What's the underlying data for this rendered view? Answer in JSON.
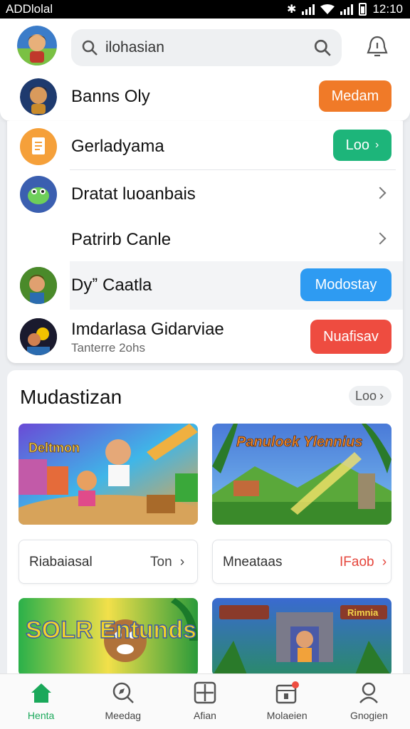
{
  "status_bar": {
    "carrier": "ADDlolal",
    "time": "12:10"
  },
  "header": {
    "search": {
      "value": "ilohasian"
    },
    "user": {
      "name": "Banns Oly",
      "button": "Medam"
    }
  },
  "list": [
    {
      "label": "Gerladyama",
      "button": "Loo"
    },
    {
      "label": "Dratat luoanbais"
    },
    {
      "label": "Patrirb Canle"
    },
    {
      "label": "Dyˮ Caatla",
      "button": "Modostay"
    },
    {
      "label": "Imdarlasa Gidarviae",
      "sublabel": "Tanterre 2ohs",
      "button": "Nuafisav"
    }
  ],
  "section": {
    "title": "Mudastizan",
    "see_all": "Loo",
    "thumbs": [
      {
        "caption": "Deltmon"
      },
      {
        "caption": "Panuloek Ylennius"
      },
      {
        "caption": "SOLR Entunds"
      },
      {
        "caption": "Rimnia"
      }
    ],
    "cards": [
      {
        "label": "Riabaiasal",
        "action": "Ton"
      },
      {
        "label": "Mneataas",
        "action": "IFaob"
      }
    ]
  },
  "nav": [
    {
      "label": "Henta",
      "icon": "home-icon",
      "active": true
    },
    {
      "label": "Meedag",
      "icon": "compass-icon",
      "active": false
    },
    {
      "label": "Afian",
      "icon": "grid-icon",
      "active": false
    },
    {
      "label": "Molaeien",
      "icon": "calendar-icon",
      "active": false
    },
    {
      "label": "Gnogien",
      "icon": "profile-icon",
      "active": false
    }
  ],
  "colors": {
    "orange": "#f07a28",
    "green": "#1db57a",
    "blue": "#2e9bf2",
    "red": "#ee4c40",
    "nav_active": "#1aa85a"
  }
}
